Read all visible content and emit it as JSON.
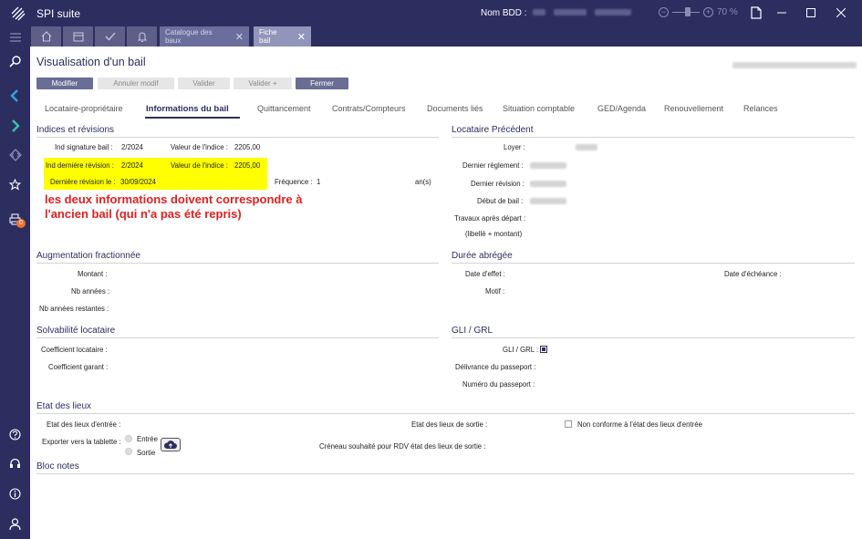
{
  "app": {
    "title": "SPI suite",
    "db_label": "Nom BDD :",
    "zoom": "70 %",
    "zoom_minus": "−",
    "zoom_plus": "+"
  },
  "tabs": {
    "doc_tabs": [
      {
        "label": "Catalogue des baux"
      },
      {
        "label": "Fiche bail"
      }
    ],
    "close_glyph": "✕"
  },
  "sidebar": {
    "print_badge": "0"
  },
  "page": {
    "title": "Visualisation d'un bail"
  },
  "toolbar": {
    "modifier": "Modifier",
    "annuler": "Annuler modif",
    "valider": "Valider",
    "valider_plus": "Valider +",
    "fermer": "Fermer"
  },
  "nav_tabs": [
    "Locataire-propriétaire",
    "Informations du bail",
    "Quittancement",
    "Contrats/Compteurs",
    "Documents liés",
    "Situation comptable",
    "GED/Agenda",
    "Renouvellement",
    "Relances"
  ],
  "indices": {
    "title": "Indices et révisions",
    "ind_signature_label": "Ind signature bail :",
    "ind_signature_value": "2/2024",
    "valeur_indice_label": "Valeur de l'indice :",
    "valeur_indice_value": "2205,00",
    "ind_derniere_label": "Ind dernière révision :",
    "ind_derniere_value": "2/2024",
    "valeur_indice2_label": "Valeur de l'indice :",
    "valeur_indice2_value": "2205,00",
    "derniere_revision_label": "Dernière révision le :",
    "derniere_revision_value": "30/09/2024",
    "frequence_label": "Fréquence :",
    "frequence_value": "1",
    "frequence_unit": "an(s)"
  },
  "annotation": {
    "line1": "les deux informations doivent correspondre à",
    "line2": "l'ancien bail (qui n'a pas été repris)"
  },
  "locataire_precedent": {
    "title": "Locataire Précédent",
    "loyer": "Loyer :",
    "dernier_reglement": "Dernier règlement :",
    "derniere_revision": "Dernier révision :",
    "debut_bail": "Début de bail :",
    "travaux": "Travaux après départ :",
    "travaux_sub": "(libellé + montant)"
  },
  "augmentation": {
    "title": "Augmentation fractionnée",
    "montant": "Montant :",
    "nb_annees": "Nb années :",
    "nb_annees_restantes": "Nb années restantes :"
  },
  "duree": {
    "title": "Durée abrégée",
    "date_effet": "Date d'effet :",
    "date_echeance": "Date d'échéance :",
    "motif": "Motif :"
  },
  "solvabilite": {
    "title": "Solvabilité locataire",
    "coef_locataire": "Coefficient locataire :",
    "coef_garant": "Coefficient garant :"
  },
  "gli": {
    "title": "GLI / GRL",
    "gli_label": "GLI / GRL :",
    "delivrance": "Délivrance du passeport :",
    "numero": "Numéro du passeport :"
  },
  "etat_lieux": {
    "title": "Etat des lieux",
    "entree": "Etat des lieux d'entrée :",
    "sortie": "Etat des lieux de sortie :",
    "non_conforme": "Non conforme à l'état des lieux d'entrée",
    "exporter": "Exporter vers la tablette :",
    "opt_entree": "Entrée",
    "opt_sortie": "Sortie",
    "creneau": "Créneau souhaité pour RDV état des lieux de sortie :"
  },
  "bloc_notes": {
    "title": "Bloc notes"
  },
  "colors": {
    "brand": "#2c2e60",
    "highlight": "#ffff00",
    "annotation": "#e02020",
    "badge": "#f07030"
  }
}
